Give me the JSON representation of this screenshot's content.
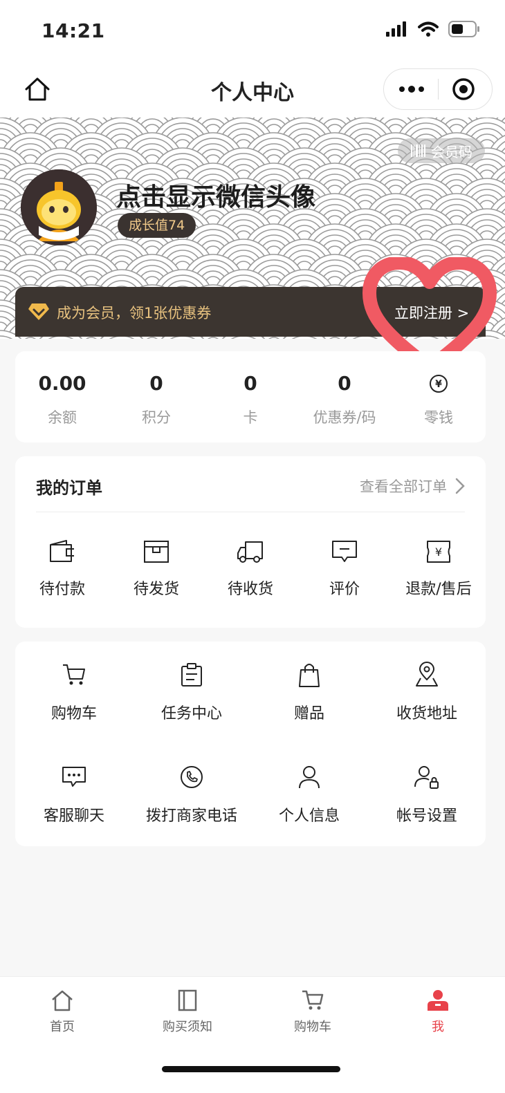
{
  "status_bar": {
    "time": "14:21"
  },
  "nav": {
    "title": "个人中心"
  },
  "header": {
    "member_code_label": "会员码",
    "username": "点击显示微信头像",
    "growth_label": "成长值74"
  },
  "member_strip": {
    "text": "成为会员，领1张优惠券",
    "register_label": "立即注册 >"
  },
  "stats": [
    {
      "value": "0.00",
      "label": "余额"
    },
    {
      "value": "0",
      "label": "积分"
    },
    {
      "value": "0",
      "label": "卡"
    },
    {
      "value": "0",
      "label": "优惠券/码"
    },
    {
      "value": "",
      "label": "零钱"
    }
  ],
  "orders": {
    "title": "我的订单",
    "view_all": "查看全部订单",
    "items": [
      {
        "label": "待付款",
        "icon": "wallet-icon"
      },
      {
        "label": "待发货",
        "icon": "box-icon"
      },
      {
        "label": "待收货",
        "icon": "truck-icon"
      },
      {
        "label": "评价",
        "icon": "comment-icon"
      },
      {
        "label": "退款/售后",
        "icon": "refund-icon"
      }
    ]
  },
  "tools": [
    {
      "label": "购物车",
      "icon": "cart-icon"
    },
    {
      "label": "任务中心",
      "icon": "clipboard-icon"
    },
    {
      "label": "赠品",
      "icon": "gift-bag-icon"
    },
    {
      "label": "收货地址",
      "icon": "location-icon"
    },
    {
      "label": "客服聊天",
      "icon": "chat-icon"
    },
    {
      "label": "拨打商家电话",
      "icon": "phone-icon"
    },
    {
      "label": "个人信息",
      "icon": "user-icon"
    },
    {
      "label": "帐号设置",
      "icon": "user-lock-icon"
    }
  ],
  "tab_bar": [
    {
      "label": "首页",
      "icon": "home-icon"
    },
    {
      "label": "购买须知",
      "icon": "book-icon"
    },
    {
      "label": "购物车",
      "icon": "cart-icon"
    },
    {
      "label": "我",
      "icon": "profile-icon",
      "active": true
    }
  ],
  "colors": {
    "accent": "#e8424a",
    "strip_bg": "#3c3530",
    "strip_text": "#e8c27f",
    "heart": "#f05a63"
  }
}
